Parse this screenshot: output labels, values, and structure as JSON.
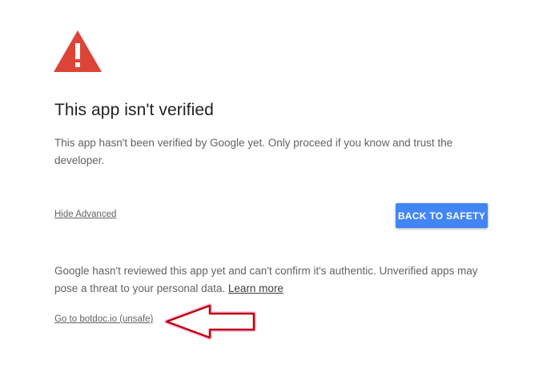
{
  "icon": {
    "name": "warning-triangle-icon",
    "color": "#db4437"
  },
  "title": "This app isn't verified",
  "description": "This app hasn't been verified by Google yet. Only proceed if you know and trust the developer.",
  "hide_advanced_label": "Hide Advanced",
  "back_to_safety_label": "BACK TO SAFETY",
  "advanced": {
    "text": "Google hasn't reviewed this app yet and can't confirm it's authentic. Unverified apps may pose a threat to your personal data.",
    "learn_more_label": "Learn more",
    "go_link_label": "Go to botdoc.io (unsafe)"
  },
  "annotation": {
    "name": "red-arrow-annotation",
    "color": "#c00000"
  },
  "colors": {
    "accent": "#4285f4",
    "warning": "#db4437"
  }
}
